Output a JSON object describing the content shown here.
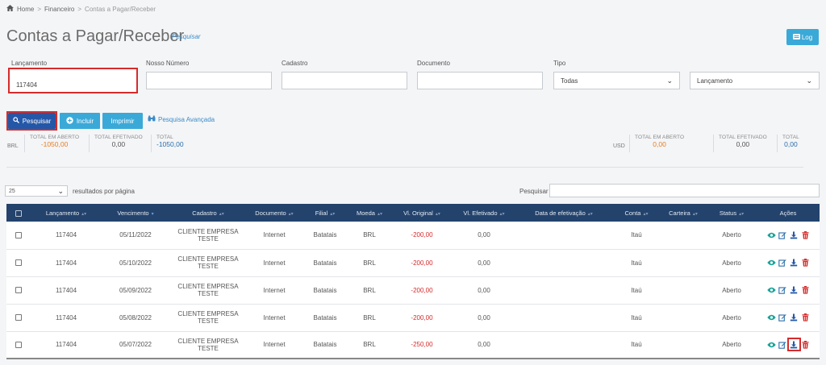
{
  "breadcrumb": {
    "home": "Home",
    "sep": ">",
    "section": "Financeiro",
    "current": "Contas a Pagar/Receber"
  },
  "page": {
    "title": "Contas a Pagar/Receber",
    "search_link": "Pesquisar",
    "log_button": "Log"
  },
  "filters": {
    "lancamento": {
      "label": "Lançamento",
      "value": "117404"
    },
    "nosso_numero": {
      "label": "Nosso Número",
      "value": ""
    },
    "cadastro": {
      "label": "Cadastro",
      "value": ""
    },
    "documento": {
      "label": "Documento",
      "value": ""
    },
    "tipo": {
      "label": "Tipo",
      "value": "Todas"
    },
    "order_by": {
      "value": "Lançamento"
    }
  },
  "buttons": {
    "search": "Pesquisar",
    "add": "Incluir",
    "print": "Imprimir",
    "advanced": "Pesquisa Avançada"
  },
  "totals_brl": {
    "currency": "BRL",
    "open": {
      "label": "TOTAL EM ABERTO",
      "value": "-1050,00"
    },
    "paid": {
      "label": "TOTAL EFETIVADO",
      "value": "0,00"
    },
    "total": {
      "label": "TOTAL",
      "value": "-1050,00"
    }
  },
  "totals_usd": {
    "currency": "USD",
    "open": {
      "label": "TOTAL EM ABERTO",
      "value": "0,00"
    },
    "paid": {
      "label": "TOTAL EFETIVADO",
      "value": "0,00"
    },
    "total": {
      "label": "TOTAL",
      "value": "0,00"
    }
  },
  "table_controls": {
    "per_page": "25",
    "per_page_label": "resultados por página",
    "search_label": "Pesquisar"
  },
  "columns": [
    "Lançamento",
    "Vencimento",
    "Cadastro",
    "Documento",
    "Filial",
    "Moeda",
    "Vl. Original",
    "Vl. Efetivado",
    "Data de efetivação",
    "Conta",
    "Carteira",
    "Status",
    "Ações"
  ],
  "rows": [
    {
      "lancamento": "117404",
      "vencimento": "05/11/2022",
      "cadastro_l1": "CLIENTE EMPRESA",
      "cadastro_l2": "TESTE",
      "documento": "Internet",
      "filial": "Batatais",
      "moeda": "BRL",
      "vl_original": "-200,00",
      "vl_efetivado": "0,00",
      "data_efetivacao": "",
      "conta": "Itaú",
      "carteira": "",
      "status": "Aberto"
    },
    {
      "lancamento": "117404",
      "vencimento": "05/10/2022",
      "cadastro_l1": "CLIENTE EMPRESA",
      "cadastro_l2": "TESTE",
      "documento": "Internet",
      "filial": "Batatais",
      "moeda": "BRL",
      "vl_original": "-200,00",
      "vl_efetivado": "0,00",
      "data_efetivacao": "",
      "conta": "Itaú",
      "carteira": "",
      "status": "Aberto"
    },
    {
      "lancamento": "117404",
      "vencimento": "05/09/2022",
      "cadastro_l1": "CLIENTE EMPRESA",
      "cadastro_l2": "TESTE",
      "documento": "Internet",
      "filial": "Batatais",
      "moeda": "BRL",
      "vl_original": "-200,00",
      "vl_efetivado": "0,00",
      "data_efetivacao": "",
      "conta": "Itaú",
      "carteira": "",
      "status": "Aberto"
    },
    {
      "lancamento": "117404",
      "vencimento": "05/08/2022",
      "cadastro_l1": "CLIENTE EMPRESA",
      "cadastro_l2": "TESTE",
      "documento": "Internet",
      "filial": "Batatais",
      "moeda": "BRL",
      "vl_original": "-200,00",
      "vl_efetivado": "0,00",
      "data_efetivacao": "",
      "conta": "Itaú",
      "carteira": "",
      "status": "Aberto"
    },
    {
      "lancamento": "117404",
      "vencimento": "05/07/2022",
      "cadastro_l1": "CLIENTE EMPRESA",
      "cadastro_l2": "TESTE",
      "documento": "Internet",
      "filial": "Batatais",
      "moeda": "BRL",
      "vl_original": "-250,00",
      "vl_efetivado": "0,00",
      "data_efetivacao": "",
      "conta": "Itaú",
      "carteira": "",
      "status": "Aberto"
    }
  ],
  "row_actions": [
    "eye-icon",
    "edit-icon",
    "download-icon",
    "trash-icon"
  ],
  "colors": {
    "header_bg": "#23436d",
    "accent": "#3aa9d8",
    "search_btn": "#2457a7",
    "highlight": "#d62b2b",
    "orange": "#e67e22"
  }
}
